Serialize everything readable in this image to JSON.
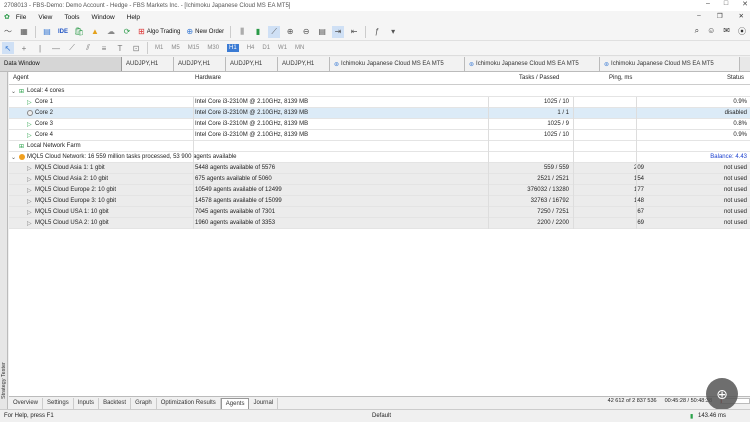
{
  "window": {
    "title": "2708013 - FBS-Demo: Demo Account - Hedge - FBS Markets Inc. - [Ichimoku Japanese Cloud MS EA MT5]"
  },
  "menu": [
    "File",
    "View",
    "Tools",
    "Window",
    "Help"
  ],
  "toolbar": {
    "algo_trading": "Algo Trading",
    "new_order": "New Order"
  },
  "timeframes": [
    "M1",
    "M5",
    "M15",
    "M30",
    "H1",
    "H4",
    "D1",
    "W1",
    "MN"
  ],
  "active_timeframe": "H1",
  "doc_tabs": [
    "Data Window",
    "AUDJPY,H1",
    "AUDJPY,H1",
    "AUDJPY,H1",
    "AUDJPY,H1",
    "Ichimoku Japanese Cloud MS EA MT5",
    "Ichimoku Japanese Cloud MS EA MT5",
    "Ichimoku Japanese Cloud MS EA MT5"
  ],
  "sidebar_label": "Strategy Tester",
  "columns": {
    "agent": "Agent",
    "hardware": "Hardware",
    "tasks": "Tasks / Passed",
    "ping": "Ping, ms",
    "status": "Status"
  },
  "groups": {
    "local": "Local: 4 cores",
    "farm": "Local Network Farm",
    "cloud": "MQL5 Cloud Network: 16 559 million tasks processed, 53 900 agents available",
    "cloud_balance": "Balance: 4.43"
  },
  "cores": [
    {
      "agent": "Core 1",
      "hardware": "Intel Core i3-2310M  @ 2.10GHz, 8139 MB",
      "tasks": "1025 / 10",
      "ping": "",
      "status": "0.9%"
    },
    {
      "agent": "Core 2",
      "hardware": "Intel Core i3-2310M  @ 2.10GHz, 8139 MB",
      "tasks": "1 / 1",
      "ping": "",
      "status": "disabled"
    },
    {
      "agent": "Core 3",
      "hardware": "Intel Core i3-2310M  @ 2.10GHz, 8139 MB",
      "tasks": "1025 / 9",
      "ping": "",
      "status": "0.8%"
    },
    {
      "agent": "Core 4",
      "hardware": "Intel Core i3-2310M  @ 2.10GHz, 8139 MB",
      "tasks": "1025 / 10",
      "ping": "",
      "status": "0.9%"
    }
  ],
  "cloud_agents": [
    {
      "agent": "MQL5 Cloud Asia 1: 1 gbit",
      "hardware": "5448 agents available of 5576",
      "tasks": "559 / 559",
      "ping": "209",
      "status": "not used"
    },
    {
      "agent": "MQL5 Cloud Asia 2: 10 gbit",
      "hardware": "675 agents available of 5060",
      "tasks": "2521 / 2521",
      "ping": "154",
      "status": "not used"
    },
    {
      "agent": "MQL5 Cloud Europe 2: 10 gbit",
      "hardware": "10549 agents available of 12499",
      "tasks": "376032 / 13280",
      "ping": "177",
      "status": "not used"
    },
    {
      "agent": "MQL5 Cloud Europe 3: 10 gbit",
      "hardware": "14578 agents available of 15099",
      "tasks": "32763 / 16792",
      "ping": "148",
      "status": "not used"
    },
    {
      "agent": "MQL5 Cloud USA 1: 10 gbit",
      "hardware": "7045 agents available of 7301",
      "tasks": "7250 / 7251",
      "ping": "67",
      "status": "not used"
    },
    {
      "agent": "MQL5 Cloud USA 2: 10 gbit",
      "hardware": "1960 agents available of 3353",
      "tasks": "2200 / 2200",
      "ping": "69",
      "status": "not used"
    }
  ],
  "bottom_tabs": [
    "Overview",
    "Settings",
    "Inputs",
    "Backtest",
    "Graph",
    "Optimization Results",
    "Agents",
    "Journal"
  ],
  "active_bottom_tab": "Agents",
  "progress": {
    "count": "42 612 of 2 837 536",
    "elapsed": "00:45:28 / 50:48:38",
    "fraction": 0.015
  },
  "status": {
    "help": "For Help, press F1",
    "profile": "Default",
    "traffic": "143.46 ms"
  },
  "colors": {
    "accent": "#3b7bd4",
    "selected_row": "#dcebf7",
    "progress": "#e04b4b",
    "balance": "#1a3fcf"
  }
}
